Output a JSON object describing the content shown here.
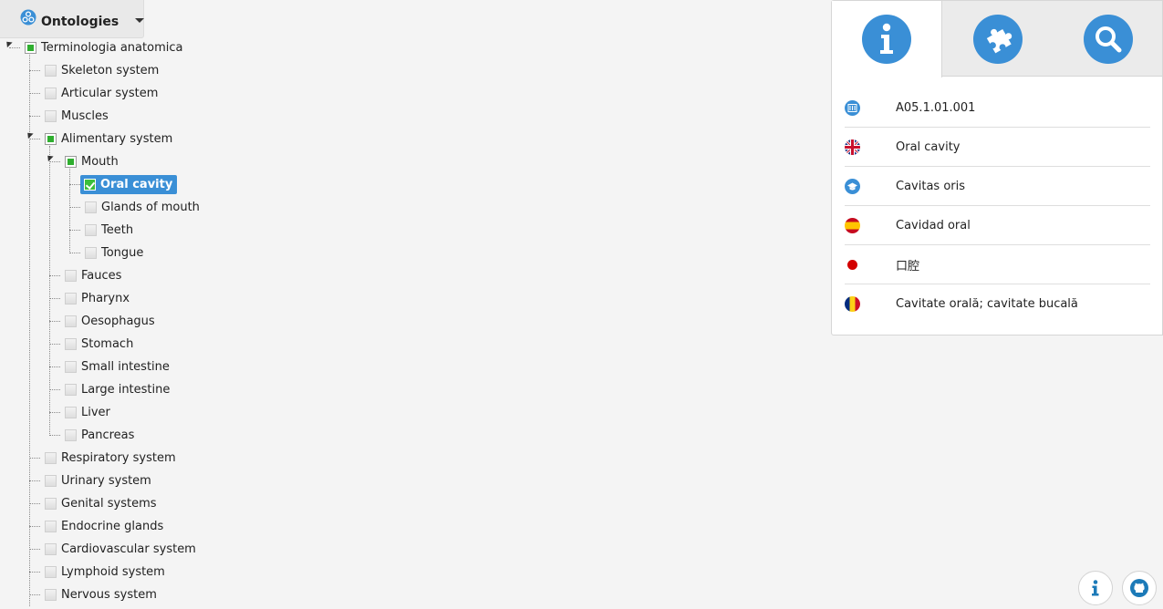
{
  "ontologies_button": {
    "label": "Ontologies"
  },
  "tree": {
    "root": "Terminologia anatomica",
    "systems": {
      "skeleton": "Skeleton system",
      "articular": "Articular system",
      "muscles": "Muscles",
      "alimentary": "Alimentary system",
      "respiratory": "Respiratory system",
      "urinary": "Urinary system",
      "genital": "Genital systems",
      "endocrine": "Endocrine glands",
      "cardiovascular": "Cardiovascular system",
      "lymphoid": "Lymphoid system",
      "nervous": "Nervous system"
    },
    "alimentary_children": {
      "mouth": "Mouth",
      "fauces": "Fauces",
      "pharynx": "Pharynx",
      "oesophagus": "Oesophagus",
      "stomach": "Stomach",
      "small_intestine": "Small intestine",
      "large_intestine": "Large intestine",
      "liver": "Liver",
      "pancreas": "Pancreas"
    },
    "mouth_children": {
      "oral_cavity": "Oral cavity",
      "glands_of_mouth": "Glands of mouth",
      "teeth": "Teeth",
      "tongue": "Tongue"
    }
  },
  "info_panel": {
    "tabs": [
      "info",
      "puzzle",
      "search"
    ],
    "rows": {
      "code": "A05.1.01.001",
      "english": "Oral cavity",
      "latin": "Cavitas oris",
      "spanish": "Cavidad oral",
      "japanese": "口腔",
      "romanian": "Cavitate orală; cavitate bucală"
    }
  },
  "colors": {
    "accent": "#3a8fd6",
    "checkbox_green": "#3bbf3b"
  }
}
